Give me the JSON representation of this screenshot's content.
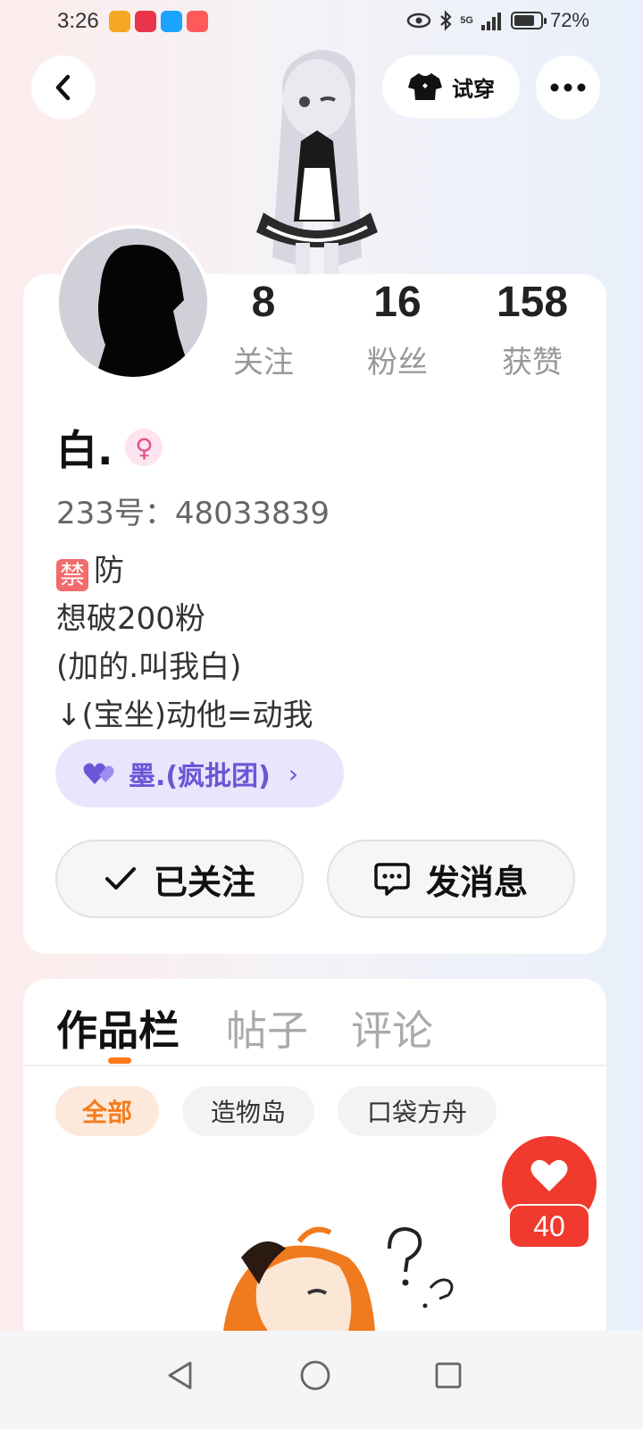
{
  "status_bar": {
    "time": "3:26",
    "network": "5G",
    "battery": "72%"
  },
  "header": {
    "tryon_label": "试穿"
  },
  "profile": {
    "stats": [
      {
        "value": "8",
        "label": "关注"
      },
      {
        "value": "16",
        "label": "粉丝"
      },
      {
        "value": "158",
        "label": "获赞"
      }
    ],
    "name": "白.",
    "gender_symbol": "♀",
    "uid": "233号：48033839",
    "bio_badge": "禁",
    "bio_lines": [
      "防",
      "想破200粉",
      "(加的.叫我白)",
      "↓(宝坐)动他=动我"
    ],
    "group": {
      "label": "墨.(疯批团)",
      "chevron": "›"
    },
    "follow_label": "已关注",
    "message_label": "发消息"
  },
  "works": {
    "tabs": [
      "作品栏",
      "帖子",
      "评论"
    ],
    "filters": [
      "全部",
      "造物岛",
      "口袋方舟"
    ],
    "like_count": "40"
  },
  "colors": {
    "accent": "#ff7a1a",
    "like_red": "#f03a2e",
    "group_purple": "#6a56d6",
    "gender_pink": "#e6508a"
  }
}
